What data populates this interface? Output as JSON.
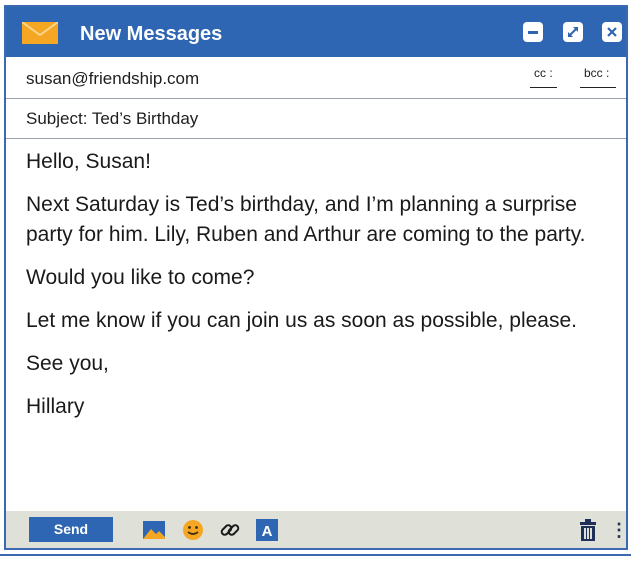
{
  "window": {
    "title": "New Messages"
  },
  "to": {
    "value": "susan@friendship.com",
    "cc_label": "cc :",
    "bcc_label": "bcc :"
  },
  "subject": {
    "text": "Subject: Ted’s Birthday"
  },
  "message": {
    "paragraphs": [
      "Hello, Susan!",
      "Next Saturday is Ted’s birthday, and I’m planning a surprise party for him. Lily, Ruben and Arthur are coming to the party.",
      "Would you like to come?",
      "Let me know if you can join us as soon as possible, please.",
      "See you,",
      "Hillary"
    ]
  },
  "toolbar": {
    "send_label": "Send",
    "font_icon_letter": "A",
    "more_glyph": "⋮",
    "icons": [
      "image-icon",
      "emoji-icon",
      "link-icon",
      "font-icon",
      "trash-icon",
      "more-icon"
    ]
  },
  "colors": {
    "accent": "#2f66b3",
    "envelope": "#f5a623",
    "toolbar_bg": "#dfe1d9"
  }
}
